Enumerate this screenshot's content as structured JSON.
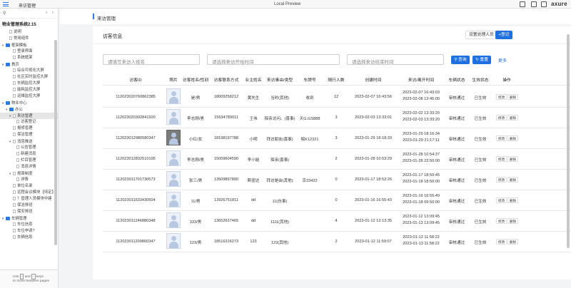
{
  "window": {
    "page_title": "来访管理",
    "preview_label": "Local Preview",
    "brand": "axure"
  },
  "sidebar": {
    "project_title": "物业管理系统2.15",
    "items": [
      {
        "label": "说明",
        "kind": "page",
        "indent": 1
      },
      {
        "label": "常用组件",
        "kind": "page",
        "indent": 1
      },
      {
        "label": "框架模板",
        "kind": "folder",
        "indent": 0,
        "toggle": "▾"
      },
      {
        "label": "登录界面",
        "kind": "page",
        "indent": 2
      },
      {
        "label": "系统框架",
        "kind": "page",
        "indent": 2
      },
      {
        "label": "首页",
        "kind": "folder",
        "indent": 0,
        "toggle": "▾"
      },
      {
        "label": "综合可视化大屏",
        "kind": "page",
        "indent": 2
      },
      {
        "label": "社区实时监控大屏",
        "kind": "page",
        "indent": 2
      },
      {
        "label": "车辆监控大屏",
        "kind": "page",
        "indent": 2
      },
      {
        "label": "能耗监控大屏",
        "kind": "page",
        "indent": 2
      },
      {
        "label": "运维监控大屏",
        "kind": "page",
        "indent": 2
      },
      {
        "label": "物业中心",
        "kind": "folder",
        "indent": 0,
        "toggle": "▾"
      },
      {
        "label": "办公",
        "kind": "folder",
        "indent": 1,
        "toggle": "▾"
      },
      {
        "label": "来访管理",
        "kind": "page",
        "indent": 2,
        "toggle": "▾",
        "selected": true
      },
      {
        "label": "访客登记",
        "kind": "page",
        "indent": 3
      },
      {
        "label": "报修管理",
        "kind": "page",
        "indent": 2
      },
      {
        "label": "保洁管理",
        "kind": "page",
        "indent": 2
      },
      {
        "label": "消息推送",
        "kind": "page",
        "indent": 2,
        "toggle": "▾"
      },
      {
        "label": "公告管理",
        "kind": "page",
        "indent": 3
      },
      {
        "label": "新建消息",
        "kind": "page",
        "indent": 3
      },
      {
        "label": "栏目管理",
        "kind": "page",
        "indent": 3
      },
      {
        "label": "消息详情",
        "kind": "page",
        "indent": 3
      },
      {
        "label": "规章制度",
        "kind": "page",
        "indent": 2,
        "toggle": "▾"
      },
      {
        "label": "详情",
        "kind": "page",
        "indent": 3
      },
      {
        "label": "单位名录",
        "kind": "page",
        "indent": 2
      },
      {
        "label": "远程会议模块【待定】",
        "kind": "page",
        "indent": 2
      },
      {
        "label": "？管理人员模块中建",
        "kind": "page",
        "indent": 2
      },
      {
        "label": "保洁排班",
        "kind": "page",
        "indent": 2
      },
      {
        "label": "保安排班",
        "kind": "page",
        "indent": 2
      },
      {
        "label": "车辆管理",
        "kind": "folder",
        "indent": 0,
        "toggle": "▾"
      },
      {
        "label": "车位信息",
        "kind": "page",
        "indent": 2
      },
      {
        "label": "车位申请?",
        "kind": "page",
        "indent": 2
      },
      {
        "label": "车辆信息",
        "kind": "page",
        "indent": 2
      }
    ],
    "footer": {
      "line1_a": "Use",
      "key1": "‹",
      "line1_b": "and",
      "key2": "›",
      "line1_c": "keys",
      "line2": "to move between pages"
    }
  },
  "main": {
    "header_label": "来访管理",
    "card_title": "访客信息",
    "actions": {
      "settings": "设置处理人员",
      "register": "+登记"
    },
    "filters": {
      "name_placeholder": "请填写来访人姓名",
      "start_placeholder": "请选择来访开始时间",
      "end_placeholder": "请选择来访结束时间",
      "query": "查询",
      "reset": "重置",
      "more": "更多"
    },
    "columns": [
      "访客ID",
      "照片",
      "访客姓名/性别",
      "访客联系方式",
      "业主姓名",
      "来访事由/类型",
      "车牌号",
      "随行人数",
      "创建时间",
      "来访/离开时间",
      "车辆状态",
      "生效状态",
      "操作"
    ],
    "op_edit": "修改",
    "op_delete": "删除",
    "rows": [
      {
        "id": "112023020760862385",
        "photo": "light",
        "name": "是/男",
        "phone": "18009258212",
        "owner": "黄先生",
        "reason": "当时(其他)",
        "plate": "收到",
        "count": "12",
        "created": "2023-02-07 16:43:56",
        "visit": "2023-02-07 16:43:03",
        "leave": "2023-02-08 13:45:00",
        "car_status": "审核通过",
        "valid": "已生效"
      },
      {
        "id": "112023020302841920",
        "photo": "light",
        "name": "李志刚/男",
        "phone": "15634789011",
        "owner": "王伟",
        "reason": "探亲访问。(喜事)",
        "plate": "天G.GS888",
        "count": "3",
        "created": "2023-02-03 13:33:01",
        "visit": "2023-02-02 13:33:20",
        "leave": "2023-02-03 13:33:20",
        "car_status": "审核通过",
        "valid": "已生效"
      },
      {
        "id": "112023012980580347",
        "photo": "dark",
        "name": "小红/女",
        "phone": "18198197788",
        "owner": "小明",
        "reason": "拜访朋友(喜事)",
        "plate": "皖K12321",
        "count": "3",
        "created": "2023-01-29 18:18:33",
        "visit": "2023-01-29 18:16:34",
        "leave": "2023-01-29 21:17:11",
        "car_status": "审核通过",
        "valid": "已生效"
      },
      {
        "id": "112023012832510195",
        "photo": "light",
        "name": "李志刚/男",
        "phone": "15009604590",
        "owner": "李小姐",
        "reason": "探亲(喜事)",
        "plate": "",
        "count": "2",
        "created": "2023-01-28 10:53:29",
        "visit": "2023-01-28 10:54:37",
        "leave": "2023-01-28 22:50:00",
        "car_status": "审核通过",
        "valid": "已生效"
      },
      {
        "id": "112023011701730573",
        "photo": "light",
        "name": "张三/男",
        "phone": "13509897890",
        "owner": "斯密达",
        "reason": "拜访是由(其他)",
        "plate": "京23422",
        "count": "0",
        "created": "2023-01-17 18:52:26",
        "visit": "2023-01-17 18:50:45",
        "leave": "2023-01-18 18:50:00",
        "car_status": "审核通过",
        "valid": "已生效"
      },
      {
        "id": "112023011633430504",
        "photo": "light",
        "name": "11/男",
        "phone": "13926751811",
        "owner": "dd",
        "reason": "11(白事)",
        "plate": "",
        "count": "0",
        "created": "2023-01-16 16:55:43",
        "visit": "2023-01-16 16:55:49",
        "leave": "2023-01-18 09:50:00",
        "car_status": "审核通过",
        "valid": "已生效"
      },
      {
        "id": "112023011246880348",
        "photo": "light",
        "name": "333/男",
        "phone": "13652637465",
        "owner": "dd",
        "reason": "1111(其他)",
        "plate": "",
        "count": "4",
        "created": "2023-01-12 13:13:35",
        "visit": "2023-01-12 13:09:45",
        "leave": "2023-01-13 13:09:45",
        "car_status": "审核通过",
        "valid": "已生效"
      },
      {
        "id": "112023011209800347",
        "photo": "light",
        "name": "123/男",
        "phone": "18516316273",
        "owner": "123",
        "reason": "123(其他)",
        "plate": "",
        "count": "2",
        "created": "2023-01-12 11:59:07",
        "visit": "2023-01-12 11:58:22",
        "leave": "2023-01-13 11:58:22",
        "car_status": "审核通过",
        "valid": "已生效"
      }
    ]
  },
  "colors": {
    "accent": "#1e6fe0",
    "folder": "#2a7be4"
  }
}
